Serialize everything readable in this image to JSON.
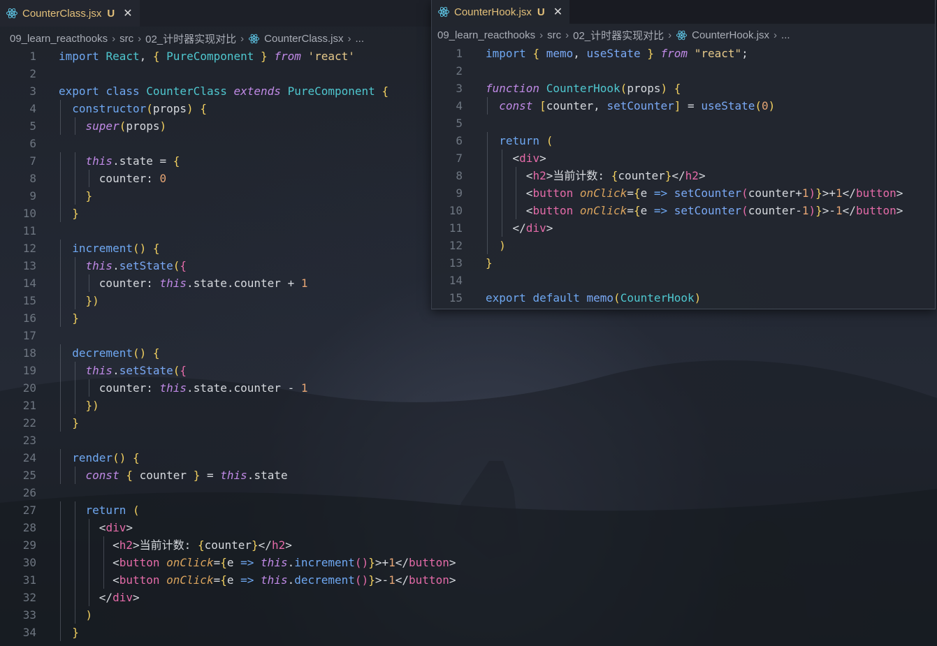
{
  "left": {
    "tab": {
      "filename": "CounterClass.jsx",
      "status": "U",
      "close": "✕"
    },
    "breadcrumb": {
      "project": "09_learn_reacthooks",
      "src": "src",
      "folder": "02_计时器实现对比",
      "file": "CounterClass.jsx",
      "more": "..."
    },
    "line_numbers": [
      "1",
      "2",
      "3",
      "4",
      "5",
      "6",
      "7",
      "8",
      "9",
      "10",
      "11",
      "12",
      "13",
      "14",
      "15",
      "16",
      "17",
      "18",
      "19",
      "20",
      "21",
      "22",
      "23",
      "24",
      "25",
      "26",
      "27",
      "28",
      "29",
      "30",
      "31",
      "32",
      "33",
      "34"
    ],
    "code": [
      "import React, { PureComponent } from 'react'",
      "",
      "export class CounterClass extends PureComponent {",
      "  constructor(props) {",
      "    super(props)",
      "",
      "    this.state = {",
      "      counter: 0",
      "    }",
      "  }",
      "",
      "  increment() {",
      "    this.setState({",
      "      counter: this.state.counter + 1",
      "    })",
      "  }",
      "",
      "  decrement() {",
      "    this.setState({",
      "      counter: this.state.counter - 1",
      "    })",
      "  }",
      "",
      "  render() {",
      "    const { counter } = this.state",
      "",
      "    return (",
      "      <div>",
      "        <h2>当前计数: {counter}</h2>",
      "        <button onClick={e => this.increment()}>+1</button>",
      "        <button onClick={e => this.decrement()}>-1</button>",
      "      </div>",
      "    )",
      "  }"
    ]
  },
  "right": {
    "tab": {
      "filename": "CounterHook.jsx",
      "status": "U",
      "close": "✕"
    },
    "breadcrumb": {
      "project": "09_learn_reacthooks",
      "src": "src",
      "folder": "02_计时器实现对比",
      "file": "CounterHook.jsx",
      "more": "..."
    },
    "line_numbers": [
      "1",
      "2",
      "3",
      "4",
      "5",
      "6",
      "7",
      "8",
      "9",
      "10",
      "11",
      "12",
      "13",
      "14",
      "15"
    ],
    "code": [
      "import { memo, useState } from \"react\";",
      "",
      "function CounterHook(props) {",
      "  const [counter, setCounter] = useState(0)",
      "",
      "  return (",
      "    <div>",
      "      <h2>当前计数: {counter}</h2>",
      "      <button onClick={e => setCounter(counter+1)}>+1</button>",
      "      <button onClick={e => setCounter(counter-1)}>-1</button>",
      "    </div>",
      "  )",
      "}",
      "",
      "export default memo(CounterHook)"
    ]
  },
  "colors": {
    "keyword": "#6fa8f2",
    "italic_keyword": "#c08ae6",
    "class_name": "#4fc7cf",
    "string": "#e6c98a",
    "tag": "#e46ba8",
    "attribute": "#d9a35d",
    "modified_tab": "#e3c07a"
  },
  "icons": {
    "file": "react-icon",
    "breadcrumb_sep": "chevron-right-icon",
    "close": "close-icon"
  }
}
